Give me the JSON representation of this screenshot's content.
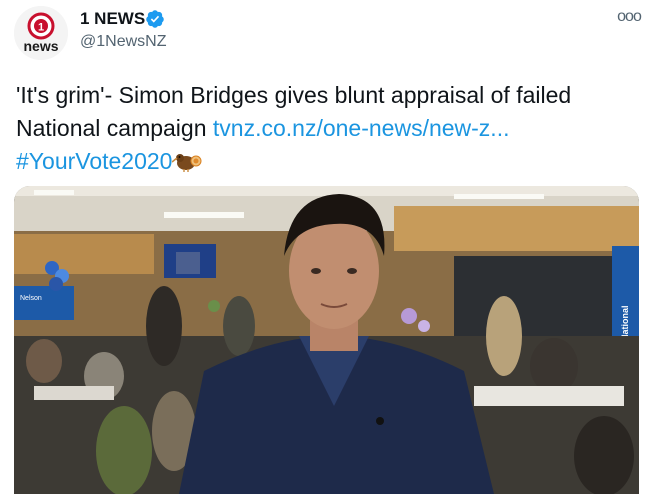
{
  "header": {
    "display_name": "1 NEWS",
    "handle": "@1NewsNZ",
    "avatar_logo_text": "news",
    "avatar_logo_number": "1",
    "more_icon": "ooo"
  },
  "tweet": {
    "text_line": "'It's grim'- Simon Bridges gives blunt appraisal of failed National campaign ",
    "link": "tvnz.co.nz/one-news/new-z...",
    "hashtag": "#YourVote2020"
  },
  "colors": {
    "link": "#1b95e0",
    "verified": "#1d9bf0",
    "logo_red": "#c8102e"
  },
  "media": {
    "description_icons": [
      "person-icon",
      "tv-screen-icon",
      "balloons-icon"
    ],
    "banner_text": "National",
    "sign_text": "Nelson"
  }
}
